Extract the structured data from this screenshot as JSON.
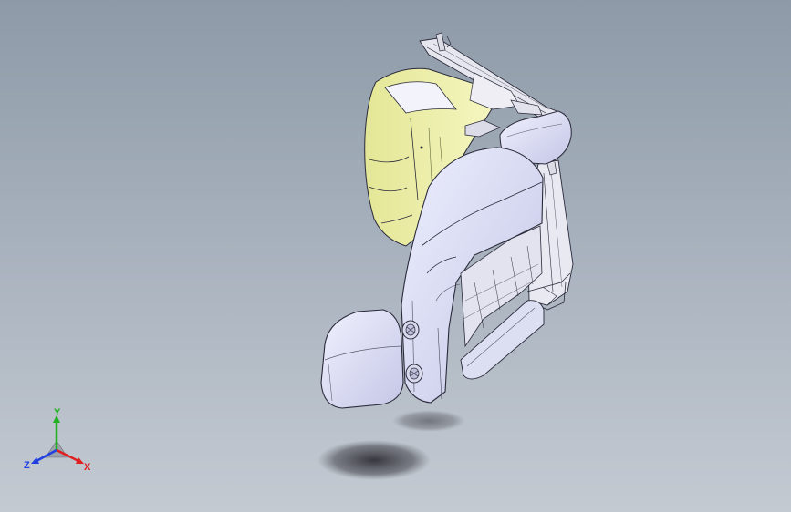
{
  "viewport": {
    "background_top": "#8e9aa8",
    "background_bottom": "#c4cad2"
  },
  "model": {
    "shell_color": "#d8d9f2",
    "interior_color": "#eef0a8",
    "frame_color": "#e8e8f0",
    "edge_color": "#2a2a3a",
    "shadow_color": "#404048"
  },
  "triad": {
    "x_label": "X",
    "y_label": "Y",
    "z_label": "Z",
    "x_color": "#e02020",
    "y_color": "#20b020",
    "z_color": "#2040e0"
  }
}
